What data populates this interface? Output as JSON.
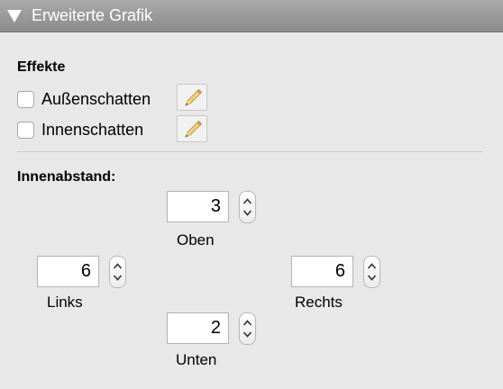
{
  "panel": {
    "title": "Erweiterte Grafik",
    "expanded": true
  },
  "effects": {
    "heading": "Effekte",
    "items": [
      {
        "label": "Außenschatten",
        "checked": false,
        "edit_icon": "pencil-icon"
      },
      {
        "label": "Innenschatten",
        "checked": false,
        "edit_icon": "pencil-icon"
      }
    ]
  },
  "padding": {
    "heading": "Innenabstand:",
    "top": {
      "label": "Oben",
      "value": "3"
    },
    "left": {
      "label": "Links",
      "value": "6"
    },
    "right": {
      "label": "Rechts",
      "value": "6"
    },
    "bottom": {
      "label": "Unten",
      "value": "2"
    }
  },
  "colors": {
    "header_bg": "#9a9a9a",
    "panel_bg": "#e8e8e8",
    "title_text": "#ffffff"
  }
}
